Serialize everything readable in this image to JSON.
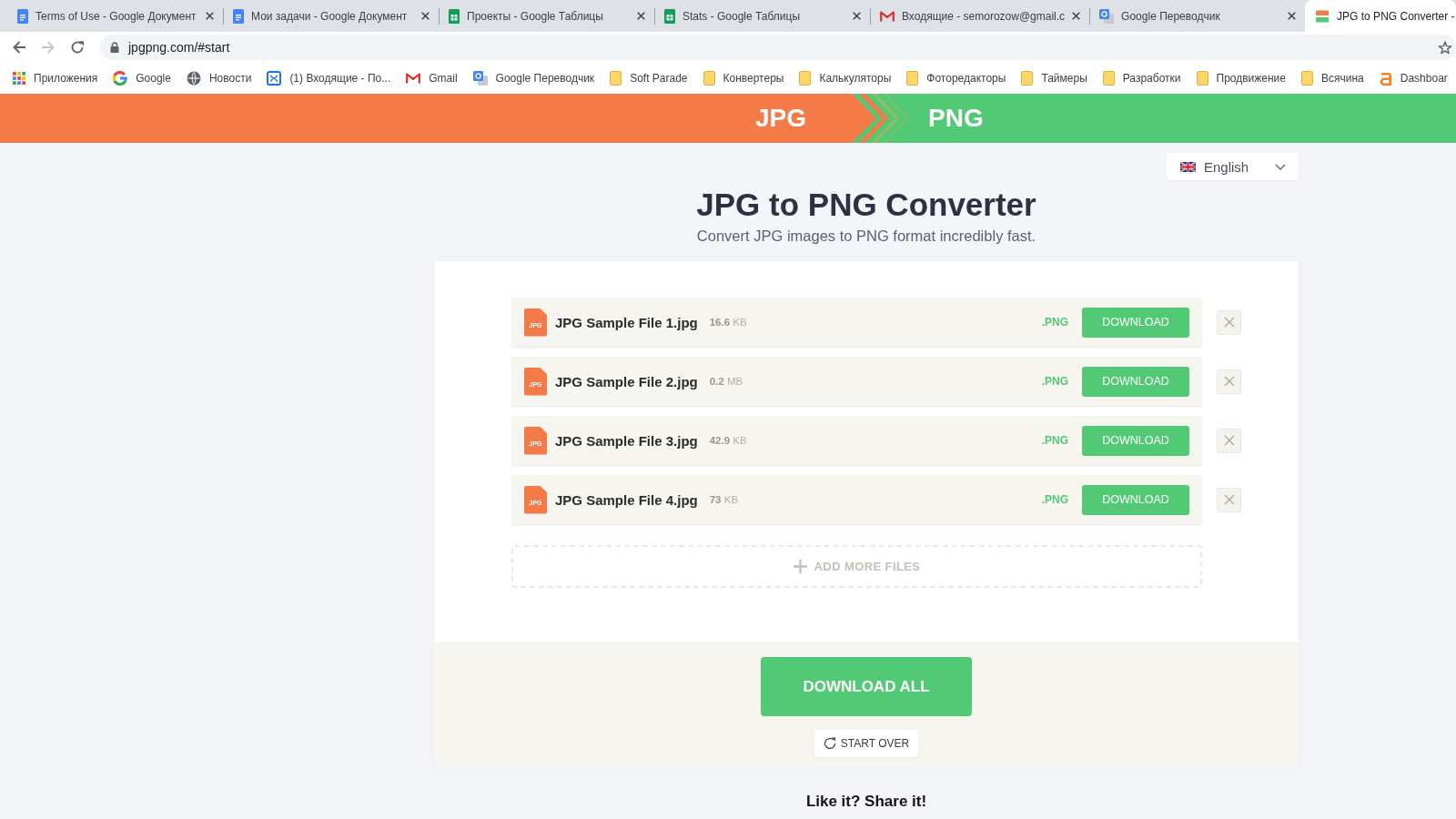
{
  "browser": {
    "tabs": [
      {
        "kind": "document",
        "title": "Terms of Use - Google Документ",
        "selected": false,
        "close_button": true
      },
      {
        "kind": "document",
        "title": "Мои задачи - Google Документ",
        "selected": false,
        "close_button": true
      },
      {
        "kind": "spreadsheet",
        "title": "Проекты - Google Таблицы",
        "selected": false,
        "close_button": true
      },
      {
        "kind": "spreadsheet",
        "title": "Stats - Google Таблицы",
        "selected": false,
        "close_button": true
      },
      {
        "kind": "mail",
        "title": "Входящие - semorozow@gmail.c",
        "selected": false,
        "close_button": true
      },
      {
        "kind": "translate",
        "title": "Google Переводчик",
        "selected": false,
        "close_button": true
      },
      {
        "kind": "site",
        "title": "JPG to PNG Converter -",
        "selected": true,
        "close_button": false
      }
    ],
    "nav_buttons": [
      {
        "kind": "back",
        "disabled": false
      },
      {
        "kind": "forward",
        "disabled": true
      },
      {
        "kind": "reload",
        "disabled": false
      }
    ],
    "address_bar": {
      "url": "jpgpng.com/#start"
    },
    "bookmarks": [
      {
        "kind": "apps",
        "label": "Приложения"
      },
      {
        "kind": "search",
        "label": "Google"
      },
      {
        "kind": "news",
        "label": "Новости"
      },
      {
        "kind": "inbox",
        "label": "(1) Входящие - По..."
      },
      {
        "kind": "mail",
        "label": "Gmail"
      },
      {
        "kind": "translate",
        "label": "Google Переводчик"
      },
      {
        "kind": "folder",
        "label": "Soft Parade"
      },
      {
        "kind": "folder",
        "label": "Конвертеры"
      },
      {
        "kind": "folder",
        "label": "Калькуляторы"
      },
      {
        "kind": "folder",
        "label": "Фоторедакторы"
      },
      {
        "kind": "folder",
        "label": "Таймеры"
      },
      {
        "kind": "folder",
        "label": "Разработки"
      },
      {
        "kind": "folder",
        "label": "Продвижение"
      },
      {
        "kind": "folder",
        "label": "Всячина"
      },
      {
        "kind": "dashboard",
        "label": "Dashboar"
      }
    ]
  },
  "banner": {
    "source_format": "JPG",
    "target_format": "PNG"
  },
  "language_select": {
    "value": "English"
  },
  "title": "JPG to PNG Converter",
  "subtitle": "Convert JPG images to PNG format incredibly fast.",
  "files": [
    {
      "type_label": "JPG",
      "name": "JPG Sample File 1.jpg",
      "size": "**16.6** KB",
      "output_format": ".PNG",
      "action": "DOWNLOAD"
    },
    {
      "type_label": "JPG",
      "name": "JPG Sample File 2.jpg",
      "size": "**0.2** MB",
      "output_format": ".PNG",
      "action": "DOWNLOAD"
    },
    {
      "type_label": "JPG",
      "name": "JPG Sample File 3.jpg",
      "size": "**42.9** KB",
      "output_format": ".PNG",
      "action": "DOWNLOAD"
    },
    {
      "type_label": "JPG",
      "name": "JPG Sample File 4.jpg",
      "size": "**73** KB",
      "output_format": ".PNG",
      "action": "DOWNLOAD"
    }
  ],
  "add_files": "ADD MORE FILES",
  "download_all": "DOWNLOAD ALL",
  "start_over": "START OVER",
  "share_heading": "Like it? Share it!"
}
